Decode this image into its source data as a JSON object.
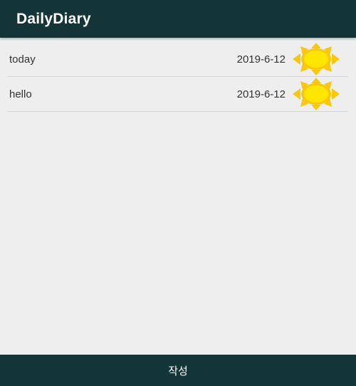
{
  "appbar": {
    "title": "DailyDiary"
  },
  "diary_entries": [
    {
      "title": "today",
      "date": "2019-6-12",
      "weather_icon": "sun-icon"
    },
    {
      "title": "hello",
      "date": "2019-6-12",
      "weather_icon": "sun-icon"
    }
  ],
  "bottom_bar": {
    "write_label": "작성"
  },
  "colors": {
    "primary_dark": "#133538",
    "background": "#eeeeee",
    "sun_yellow": "#ffe600",
    "sun_ray": "#f9c80e"
  }
}
